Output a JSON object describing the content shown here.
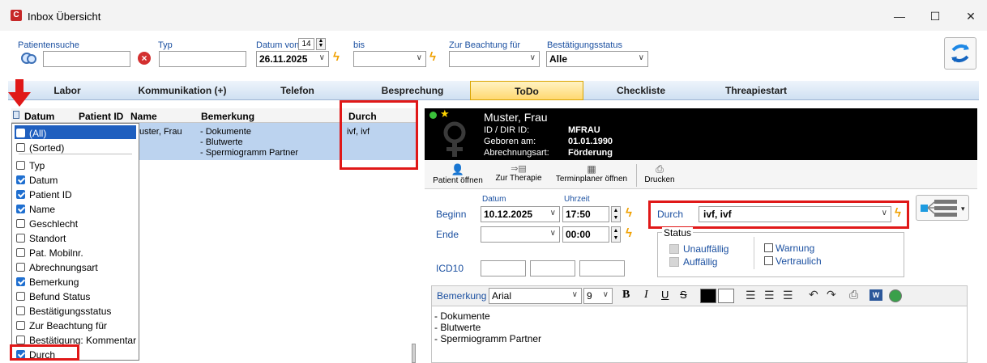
{
  "window": {
    "title": "Inbox Übersicht",
    "minimize": "—",
    "maximize": "☐",
    "close": "✕"
  },
  "toolbar": {
    "patient_search_label": "Patientensuche",
    "typ_label": "Typ",
    "date_from_label": "Datum von",
    "date_from_spin": "14",
    "date_from_value": "26.11.2025",
    "to_label": "bis",
    "attention_label": "Zur Beachtung für",
    "confirm_status_label": "Bestätigungsstatus",
    "confirm_status_value": "Alle"
  },
  "tabs": [
    "Labor",
    "Kommunikation (+)",
    "Telefon",
    "Besprechung",
    "ToDo",
    "Checkliste",
    "Threapiestart"
  ],
  "active_tab": "ToDo",
  "grid": {
    "headers": {
      "datum": "Datum",
      "patient_id": "Patient ID",
      "name": "Name",
      "bemerkung": "Bemerkung",
      "durch": "Durch"
    },
    "row": {
      "name": "uster, Frau",
      "bemerkung": [
        "- Dokumente",
        "- Blutwerte",
        "- Spermiogramm Partner"
      ],
      "durch": "ivf, ivf"
    }
  },
  "column_chooser": [
    {
      "label": "(All)",
      "checked": true,
      "highlight": true
    },
    {
      "label": "(Sorted)",
      "checked": false
    },
    {
      "label": "Typ",
      "checked": false
    },
    {
      "label": "Datum",
      "checked": true
    },
    {
      "label": "Patient ID",
      "checked": true
    },
    {
      "label": "Name",
      "checked": true
    },
    {
      "label": "Geschlecht",
      "checked": false
    },
    {
      "label": "Standort",
      "checked": false
    },
    {
      "label": "Pat. Mobilnr.",
      "checked": false
    },
    {
      "label": "Abrechnungsart",
      "checked": false
    },
    {
      "label": "Bemerkung",
      "checked": true
    },
    {
      "label": "Befund Status",
      "checked": false
    },
    {
      "label": "Bestätigungsstatus",
      "checked": false
    },
    {
      "label": "Zur Beachtung für",
      "checked": false
    },
    {
      "label": "Bestätigung: Kommentar",
      "checked": false
    },
    {
      "label": "Durch",
      "checked": true
    }
  ],
  "patient": {
    "name": "Muster, Frau",
    "id_label": "ID / DIR ID:",
    "id_value": "MFRAU",
    "born_label": "Geboren am:",
    "born_value": "01.01.1990",
    "billing_label": "Abrechnungsart:",
    "billing_value": "Förderung"
  },
  "actions": {
    "open_patient": "Patient öffnen",
    "to_therapy": "Zur Therapie",
    "open_scheduler": "Terminplaner öffnen",
    "print": "Drucken"
  },
  "form": {
    "date_col": "Datum",
    "time_col": "Uhrzeit",
    "begin_label": "Beginn",
    "begin_date": "10.12.2025",
    "begin_time": "17:50",
    "end_label": "Ende",
    "end_time": "00:00",
    "durch_label": "Durch",
    "durch_value": "ivf, ivf",
    "status_label": "Status",
    "status_unauffaellig": "Unauffällig",
    "status_auffaellig": "Auffällig",
    "warnung": "Warnung",
    "vertraulich": "Vertraulich",
    "icd10_label": "ICD10",
    "bemerkung_label": "Bemerkung",
    "font_value": "Arial",
    "font_size": "9",
    "bemerkung_text": [
      "- Dokumente",
      "- Blutwerte",
      "- Spermiogramm Partner"
    ]
  },
  "colors": {
    "accent_red": "#e01818",
    "tab_active": "#ffd870",
    "selection": "#bcd3ef",
    "link_blue": "#1a4fa0"
  }
}
